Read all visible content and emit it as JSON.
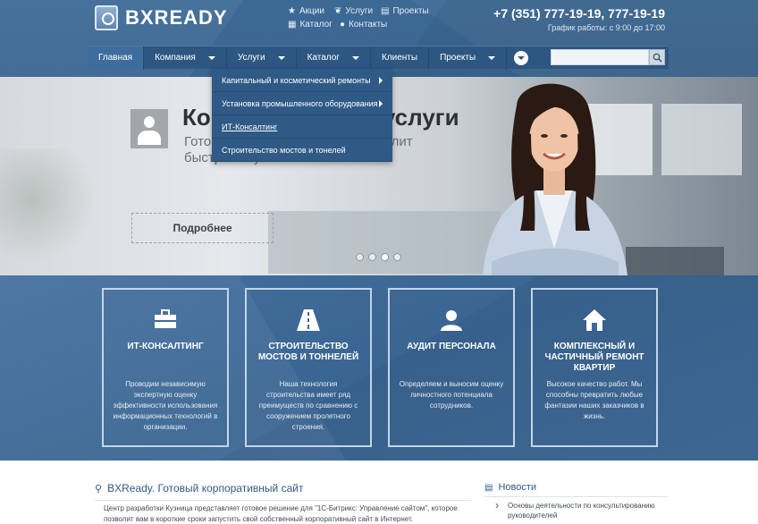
{
  "header": {
    "logo_text": "BXREADY",
    "links": [
      {
        "label": "Акции",
        "icon": "star-icon"
      },
      {
        "label": "Услуги",
        "icon": "leaf-icon"
      },
      {
        "label": "Проекты",
        "icon": "document-icon"
      },
      {
        "label": "Каталог",
        "icon": "grid-icon"
      },
      {
        "label": "Контакты",
        "icon": "person-icon"
      }
    ],
    "phone": "+7 (351) 777-19-19, 777-19-19",
    "hours": "График работы: с 9:00 до 17:00"
  },
  "nav": {
    "items": [
      {
        "label": "Главная"
      },
      {
        "label": "Компания"
      },
      {
        "label": "Услуги"
      },
      {
        "label": "Каталог"
      },
      {
        "label": "Клиенты"
      },
      {
        "label": "Проекты"
      }
    ],
    "search_placeholder": ""
  },
  "dropdown": {
    "items": [
      {
        "label": "Капитальный и косметический ремонты"
      },
      {
        "label": "Установка промышленного оборудования"
      },
      {
        "label": "ИТ-Консалтинг"
      },
      {
        "label": "Строительство мостов и тонелей"
      }
    ]
  },
  "hero": {
    "title": "Консалтинговые услуги",
    "subtitle": "Готовое решение BXReady позволит быстро запустить сайт компании.",
    "button": "Подробнее"
  },
  "services": [
    {
      "icon": "briefcase-icon",
      "title": "ИТ-КОНСАЛТИНГ",
      "text": "Проводим независимую экспертную оценку эффективности использования информационных технологий в организации."
    },
    {
      "icon": "road-icon",
      "title": "СТРОИТЕЛЬСТВО МОСТОВ И ТОННЕЛЕЙ",
      "text": "Наша технология строительства имеет ряд преимуществ по сравнению с сооружением пролетного строения."
    },
    {
      "icon": "user-icon",
      "title": "АУДИТ ПЕРСОНАЛА",
      "text": "Определяем и выносим оценку личностного потенциала сотрудников."
    },
    {
      "icon": "home-icon",
      "title": "КОМПЛЕКСНЫЙ И ЧАСТИЧНЫЙ РЕМОНТ КВАРТИР",
      "text": "Высокое качество работ. Мы способны превратить любые фантазии наших заказчиков в жизнь."
    }
  ],
  "about": {
    "title": "BXReady. Готовый корпоративный сайт",
    "text": "Центр разработки Кузница представляет готовое решение для \"1С-Битрикс: Управление сайтом\", которое позволит вам в короткие сроки запустить свой собственный корпоративный сайт в Интернет."
  },
  "news": {
    "title": "Новости",
    "item": "Основы деятельности по консультированию руководителей"
  }
}
